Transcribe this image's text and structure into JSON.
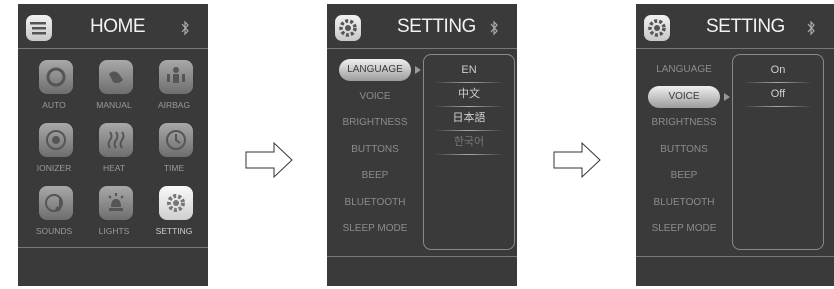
{
  "screens": {
    "home": {
      "title": "HOME",
      "items": [
        {
          "label": "AUTO",
          "icon": "auto-icon"
        },
        {
          "label": "MANUAL",
          "icon": "manual-icon"
        },
        {
          "label": "AIRBAG",
          "icon": "airbag-icon"
        },
        {
          "label": "IONIZER",
          "icon": "ionizer-icon"
        },
        {
          "label": "HEAT",
          "icon": "heat-icon"
        },
        {
          "label": "TIME",
          "icon": "clock-icon"
        },
        {
          "label": "SOUNDS",
          "icon": "music-icon"
        },
        {
          "label": "LIGHTS",
          "icon": "lamp-icon"
        },
        {
          "label": "SETTING",
          "icon": "gear-icon",
          "active": true
        }
      ]
    },
    "setting_language": {
      "title": "SETTING",
      "menu": [
        "LANGUAGE",
        "VOICE",
        "BRIGHTNESS",
        "BUTTONS",
        "BEEP",
        "BLUETOOTH",
        "SLEEP MODE"
      ],
      "selected": "LANGUAGE",
      "options": [
        "EN",
        "中文",
        "日本語",
        "한국어"
      ]
    },
    "setting_voice": {
      "title": "SETTING",
      "menu": [
        "LANGUAGE",
        "VOICE",
        "BRIGHTNESS",
        "BUTTONS",
        "BEEP",
        "BLUETOOTH",
        "SLEEP MODE"
      ],
      "selected": "VOICE",
      "options": [
        "On",
        "Off"
      ]
    }
  },
  "colors": {
    "screen_bg": "#3a3a3a",
    "text": "#dddddd",
    "dim_text": "#8c8c8c"
  }
}
